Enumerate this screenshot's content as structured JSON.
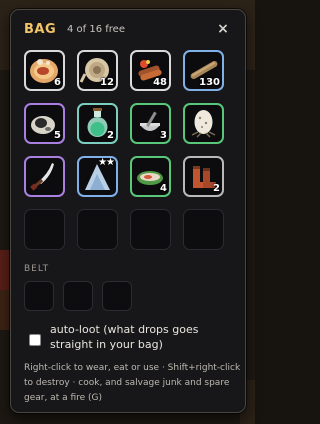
{
  "bag": {
    "title": "BAG",
    "capacity_text": "4 of 16 free",
    "close_glyph": "×",
    "slots": [
      {
        "item_icon": "cooked-meat-plate-icon",
        "count": "6",
        "rarity_color": "#d9d9d9"
      },
      {
        "item_icon": "rope-coil-icon",
        "count": "12",
        "rarity_color": "#d9d9d9"
      },
      {
        "item_icon": "firewood-bundle-icon",
        "count": "48",
        "rarity_color": "#d9d9d9"
      },
      {
        "item_icon": "wooden-stick-icon",
        "count": "130",
        "rarity_color": "#7fb0e8"
      },
      {
        "item_icon": "iron-ore-lump-icon",
        "count": "5",
        "rarity_color": "#a97fe0"
      },
      {
        "item_icon": "green-potion-flask-icon",
        "count": "2",
        "rarity_color": "#7ccfc0"
      },
      {
        "item_icon": "mortar-and-pestle-icon",
        "count": "3",
        "rarity_color": "#59c77a"
      },
      {
        "item_icon": "speckled-egg-icon",
        "count": "",
        "rarity_color": "#59c77a"
      },
      {
        "item_icon": "curved-dagger-icon",
        "count": "",
        "rarity_color": "#a97fe0"
      },
      {
        "item_icon": "cloth-hood-icon",
        "count": "",
        "stars": "★★",
        "rarity_color": "#7fb0e8"
      },
      {
        "item_icon": "cooked-fish-leaf-icon",
        "count": "4",
        "rarity_color": "#59c77a"
      },
      {
        "item_icon": "leather-boots-icon",
        "count": "2",
        "rarity_color": "#b9b9b9"
      },
      {
        "empty": true
      },
      {
        "empty": true
      },
      {
        "empty": true
      },
      {
        "empty": true
      }
    ]
  },
  "belt": {
    "label": "BELT",
    "slot_count": 3
  },
  "autoloot": {
    "checked": false,
    "label": "auto-loot (what drops goes straight in your bag)"
  },
  "help": {
    "text": "Right-click to wear, eat or use · Shift+right-click to destroy · cook, and salvage junk and spare gear, at a fire (G)"
  }
}
